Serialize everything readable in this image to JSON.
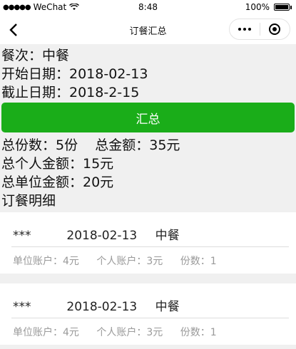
{
  "status_bar": {
    "carrier": "WeChat",
    "time": "8:48",
    "battery": "100%"
  },
  "nav": {
    "title": "订餐汇总"
  },
  "info": {
    "meal": "餐次：中餐",
    "start_date": "开始日期：2018-02-13",
    "end_date": "截止日期：2018-2-15",
    "summary_button": "汇总",
    "totals_line": "总份数：5份    总金额：35元",
    "personal_total": "总个人金额：15元",
    "unit_total": "总单位金额：20元",
    "detail_title": "订餐明细"
  },
  "orders": [
    {
      "name": "***",
      "date": "2018-02-13",
      "meal": "中餐",
      "unit_account": "单位账户：4元",
      "personal_account": "个人账户：3元",
      "count": "份数：1"
    },
    {
      "name": "***",
      "date": "2018-02-13",
      "meal": "中餐",
      "unit_account": "单位账户：4元",
      "personal_account": "个人账户：3元",
      "count": "份数：1"
    }
  ]
}
